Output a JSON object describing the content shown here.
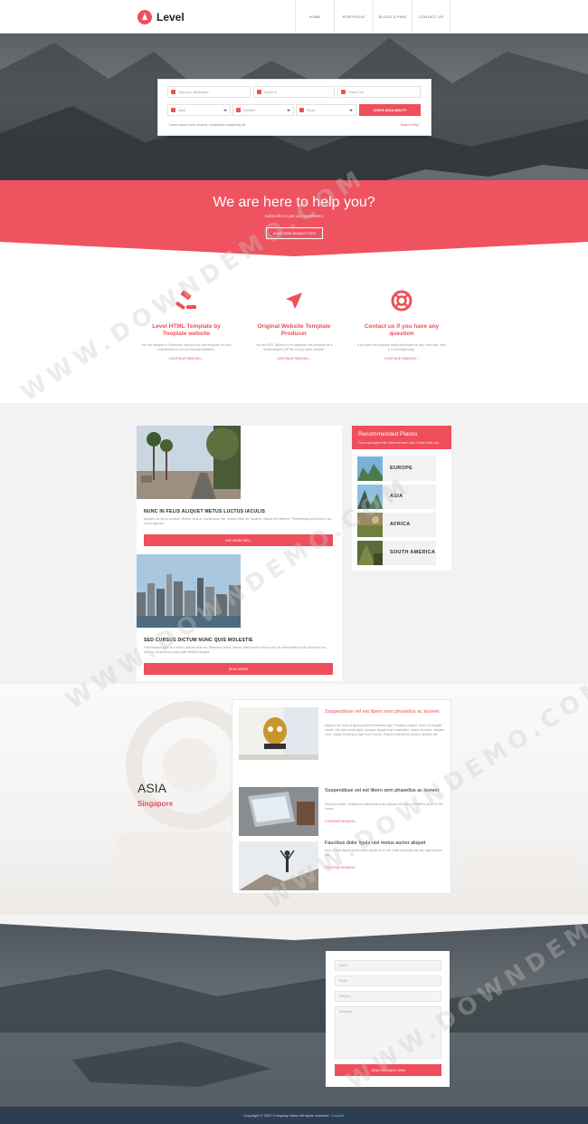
{
  "nav": {
    "brand": "Level",
    "items": [
      "HOME",
      "PORTFOLIO",
      "BLOGS & PINS",
      "CONTACT US"
    ]
  },
  "search": {
    "destination_placeholder": "Type your destination...",
    "checkin_placeholder": "Check In",
    "checkout_placeholder": "Check Out",
    "adult": "Adult",
    "children": "Children",
    "room": "Room",
    "check_button": "Check Availability",
    "note": "Lorem ipsum dolor sit amet, consectetur adipiscing elit",
    "link": "Search Help?"
  },
  "band": {
    "title": "We are here to help you?",
    "subtitle": "Subscribe to get our newsletters",
    "button": "Subscribe Newsletters"
  },
  "features": [
    {
      "title": "Level HTML Template by Tooplate website",
      "text": "You are allowed to download, edit and use this template for your commercial or non-commercial websites.",
      "link": "Continue Reading...",
      "icon": "gavel-icon"
    },
    {
      "title": "Original Website Template Producer",
      "text": "You are NOT allowed to re-distribute this template as a downloadable ZIP file on any other website.",
      "link": "Continue Reading...",
      "icon": "plane-icon"
    },
    {
      "title": "Contact us if you have any question",
      "text": "If you see this template being distributed on any other site, then it is an illegal copy.",
      "link": "Continue Reading...",
      "icon": "life-ring-icon"
    }
  ],
  "posts": [
    {
      "title": "NUNC IN FELIS ALIQUET METUS LUCTUS IACULIS",
      "text": "Aliquam ac lacus volutpat, dictum risus at, scelerisque nisl. Nullam vitae dui dapibus, aliquet elit eleifend. Pellentesque quis lectus nec lorem aliquam.",
      "button": "See More Info."
    },
    {
      "title": "SED CURSUS DICTUM NUNC QUIS MOLESTIE",
      "text": "Pellentesque quis dui varius, ultricies erat vel, bibendum tellus. Mauris ullamcorper tempor est, sit amet eleifend odio faucibus non. Nullam consectetur purus eget eleifend feugiat.",
      "button": "Read More"
    }
  ],
  "recommended": {
    "title": "Recommended Places",
    "subtitle": "Fusce quis sapien nisi. Mauris et lorem diam. Donec mollis nisl.",
    "places": [
      "EUROPE",
      "ASIA",
      "AFRICA",
      "SOUTH AMERICA"
    ]
  },
  "asia": {
    "title": "ASIA",
    "subtitle": "Singapore"
  },
  "stories": [
    {
      "title": "Suspendisse vel est libero sem phasellus ac laoreet",
      "text": "Aliquam nec dolor ut ligula pulvinar fermentum eget. Phasellus aliquet, tortor non fringilla ornare, nisi odio cursus ligula. Quisque aliquet risus consectetur, auctor elit luctus, aliquam nunc. Integer fermentum eget dui in viverra. Praesent blandit vel ultricies faucibus elit.",
      "link": "",
      "title_red": true
    },
    {
      "title": "Suspendisse vel est libero sem phasellus ac laoreet",
      "text": "Duis dolor lorem, vestibulum vitae faucibus at, aliquam non arcu. Ut eleifend lacus vel nisi ornare.",
      "link": "Continue Reading...",
      "title_red": false
    },
    {
      "title": "Faucibus dolor ligula nisl metus auctor aliquet",
      "text": "Nunc in felis aliquet metus luctus iaculis vel et nisi. Nulla venenatis nisl orci, eget ultricies nisl.",
      "link": "Continue Reading...",
      "title_red": false
    }
  ],
  "contact": {
    "name": "Name",
    "email": "Email",
    "subject": "Subject",
    "message": "Message",
    "button": "Send Message Now"
  },
  "footer": {
    "text": "Copyright © 2020 Company Name All rights reserved",
    "link": "Tooplate"
  },
  "watermark": "WWW.DOWNDEMO.COM",
  "colors": {
    "accent": "#ef4e5b",
    "footer": "#2c3e50"
  }
}
